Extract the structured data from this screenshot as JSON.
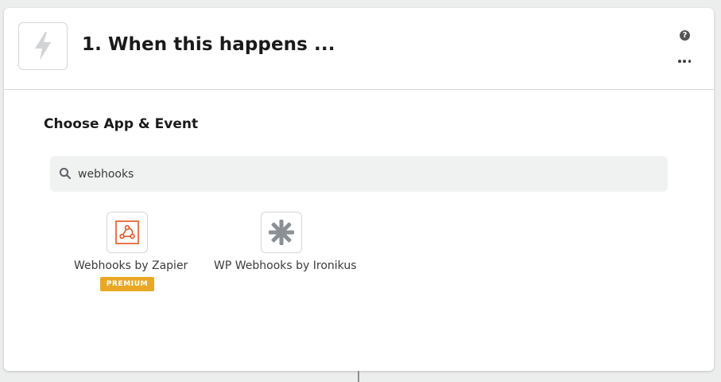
{
  "step": {
    "title": "1. When this happens ...",
    "trigger_icon": "lightning-bolt-icon",
    "help_icon_glyph": "?",
    "help_icon": "help-icon",
    "more_icon": "more-options-icon"
  },
  "chooser": {
    "title": "Choose App & Event",
    "search": {
      "value": "webhooks",
      "placeholder": "",
      "icon": "search-icon"
    }
  },
  "apps": [
    {
      "name": "Webhooks by Zapier",
      "icon": "webhook-icon",
      "icon_color": "#e8541f",
      "badge": "PREMIUM",
      "badge_color": "#e8a825"
    },
    {
      "name": "WP Webhooks by Ironikus",
      "icon": "asterisk-gear-icon",
      "icon_color": "#8a9096"
    }
  ]
}
